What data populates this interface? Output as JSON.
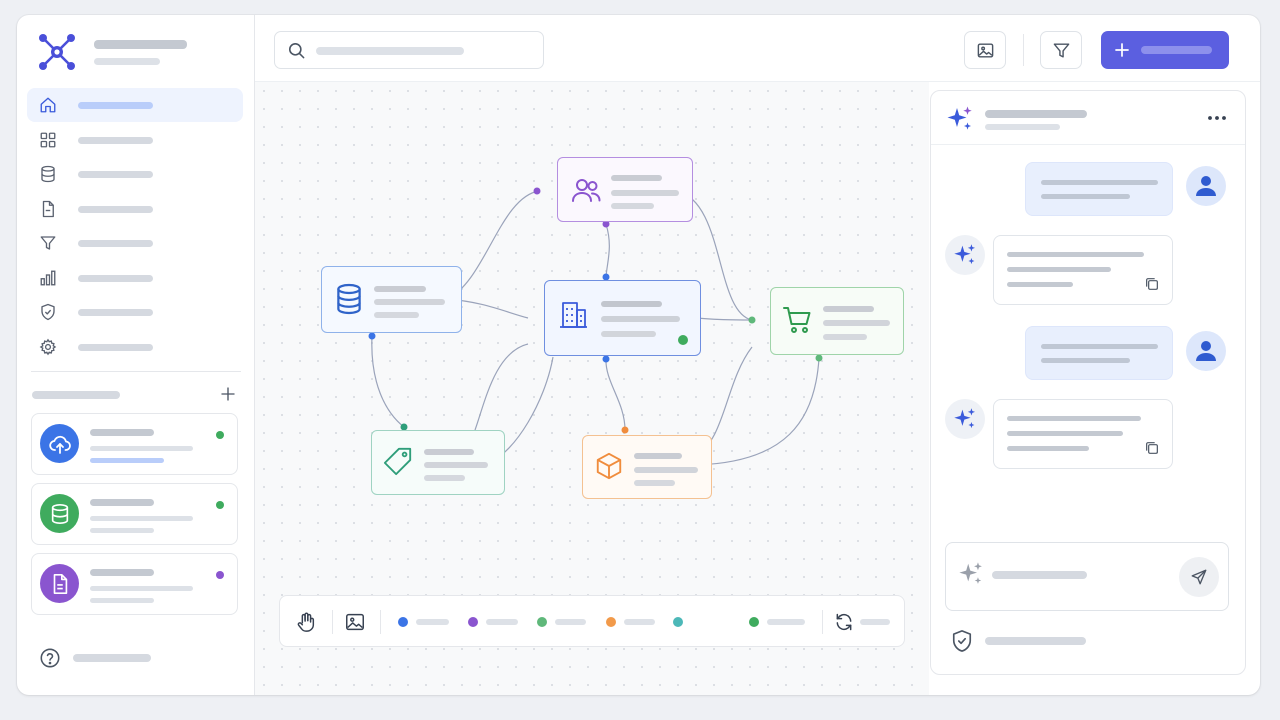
{
  "theme": {
    "accent": "#5b5fe0",
    "brand": "#4a4fd9",
    "nav_active_bg": "#eef3fe",
    "status_green": "#3fab5e",
    "status_purple": "#8a55cf"
  },
  "brand": {
    "logo_icon": "network-hub-icon"
  },
  "sidebar": {
    "items": [
      {
        "icon": "home-icon",
        "active": true
      },
      {
        "icon": "grid-icon",
        "active": false
      },
      {
        "icon": "database-icon",
        "active": false
      },
      {
        "icon": "document-icon",
        "active": false
      },
      {
        "icon": "filter-icon",
        "active": false
      },
      {
        "icon": "bar-chart-icon",
        "active": false
      },
      {
        "icon": "shield-check-icon",
        "active": false
      },
      {
        "icon": "gear-icon",
        "active": false
      }
    ],
    "section_add_icon": "plus-icon",
    "sources": [
      {
        "icon": "cloud-upload-icon",
        "color": "#3b74e6",
        "status_color": "#3fab5e",
        "progress": 0.6
      },
      {
        "icon": "database-icon",
        "color": "#3fab5e",
        "status_color": "#3fab5e"
      },
      {
        "icon": "document-icon",
        "color": "#8a55cf",
        "status_color": "#8a55cf"
      }
    ],
    "help_icon": "help-circle-icon"
  },
  "topbar": {
    "search_icon": "search-icon",
    "image_icon": "image-icon",
    "filter_icon": "filter-icon",
    "primary_icon": "plus-icon"
  },
  "graph": {
    "nodes": [
      {
        "id": "people",
        "icon": "users-icon",
        "color": "#8a55cf"
      },
      {
        "id": "database",
        "icon": "database-icon",
        "color": "#3b74e6"
      },
      {
        "id": "building",
        "icon": "building-icon",
        "color": "#3b5bdb",
        "status_color": "#3fab5e"
      },
      {
        "id": "cart",
        "icon": "shopping-cart-icon",
        "color": "#3fab5e"
      },
      {
        "id": "tag",
        "icon": "tag-icon",
        "color": "#2f9e7a"
      },
      {
        "id": "box",
        "icon": "package-icon",
        "color": "#f08c3c"
      }
    ]
  },
  "canvas_toolbar": {
    "tools": [
      "hand-icon",
      "image-icon"
    ],
    "legend_colors": [
      "#3b74e6",
      "#8a55cf",
      "#5fb87a",
      "#f29a4a",
      "#4cb8b8",
      "#3fab5e"
    ],
    "refresh_icon": "refresh-icon"
  },
  "assistant": {
    "header_icon": "sparkles-icon",
    "more_icon": "more-horizontal-icon",
    "messages": [
      {
        "role": "user",
        "avatar_icon": "user-icon"
      },
      {
        "role": "assistant",
        "avatar_icon": "sparkles-icon",
        "copy_icon": "copy-icon"
      },
      {
        "role": "user",
        "avatar_icon": "user-icon"
      },
      {
        "role": "assistant",
        "avatar_icon": "sparkles-icon",
        "copy_icon": "copy-icon"
      }
    ],
    "composer_icon": "sparkles-icon",
    "send_icon": "send-icon",
    "footer_icon": "shield-check-icon"
  }
}
